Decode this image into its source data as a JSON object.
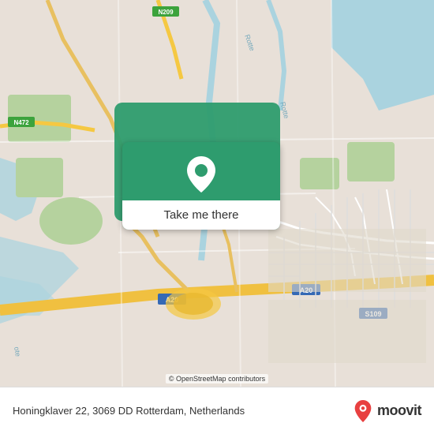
{
  "map": {
    "attribution": "© OpenStreetMap contributors",
    "bg_color": "#e8e0d8"
  },
  "button": {
    "label": "Take me there",
    "bg_color": "#2e9c6e"
  },
  "bottom_bar": {
    "address": "Honingklaver 22, 3069 DD Rotterdam, Netherlands"
  },
  "moovit": {
    "text": "moovit"
  },
  "icons": {
    "pin": "📍",
    "location_pin": "location-pin-icon"
  }
}
